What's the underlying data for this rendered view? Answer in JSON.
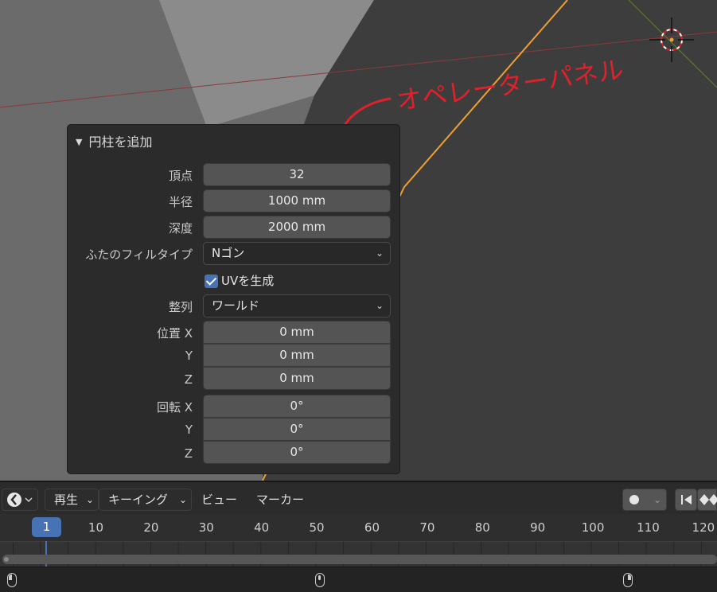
{
  "viewport": {
    "annotation_text": "オペレーターパネル",
    "annotation_color": "#e0202a",
    "selection_color": "#f0a030"
  },
  "operator_panel": {
    "title": "円柱を追加",
    "fields": {
      "vertices_label": "頂点",
      "vertices_value": "32",
      "radius_label": "半径",
      "radius_value": "1000 mm",
      "depth_label": "深度",
      "depth_value": "2000 mm",
      "cap_fill_label": "ふたのフィルタイプ",
      "cap_fill_value": "Nゴン",
      "uv_label": "UVを生成",
      "uv_checked": true,
      "align_label": "整列",
      "align_value": "ワールド",
      "location_label": "位置 X",
      "location_x": "0 mm",
      "location_y_label": "Y",
      "location_y": "0 mm",
      "location_z_label": "Z",
      "location_z": "0 mm",
      "rotation_label": "回転 X",
      "rotation_x": "0°",
      "rotation_y_label": "Y",
      "rotation_y": "0°",
      "rotation_z_label": "Z",
      "rotation_z": "0°"
    }
  },
  "timeline": {
    "menus": {
      "playback": "再生",
      "keying": "キーイング",
      "view": "ビュー",
      "marker": "マーカー"
    },
    "current_frame": "1",
    "frames": [
      "10",
      "20",
      "30",
      "40",
      "50",
      "60",
      "70",
      "80",
      "90",
      "100",
      "110",
      "120"
    ],
    "accent": "#4772b3"
  }
}
